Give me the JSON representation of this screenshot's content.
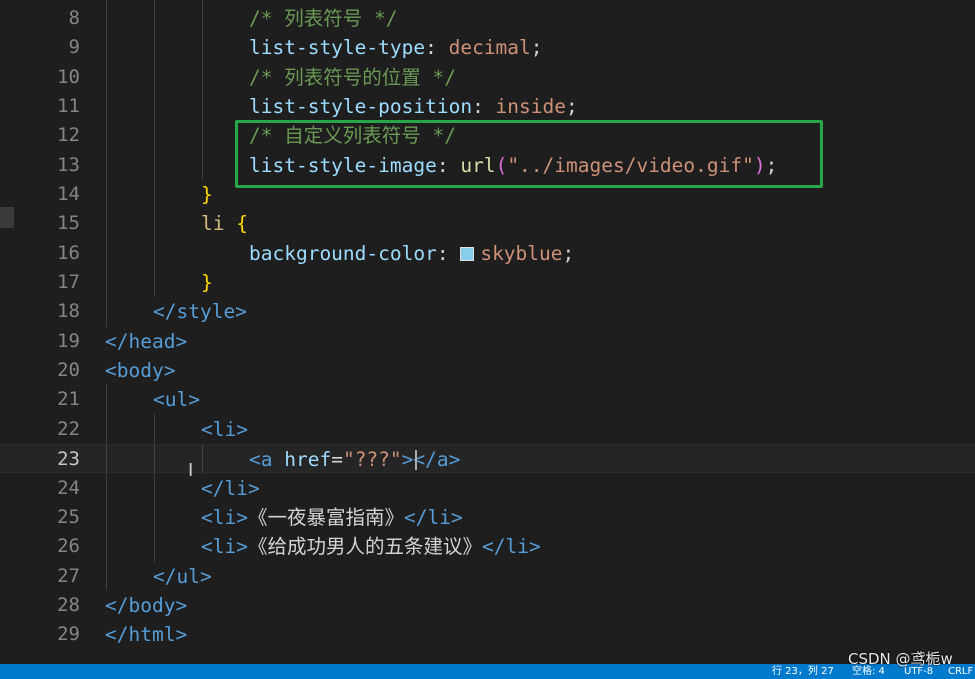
{
  "editor": {
    "active_line": "23",
    "lines": [
      {
        "num": "8"
      },
      {
        "num": "9"
      },
      {
        "num": "10"
      },
      {
        "num": "11"
      },
      {
        "num": "12"
      },
      {
        "num": "13"
      },
      {
        "num": "14"
      },
      {
        "num": "15"
      },
      {
        "num": "16"
      },
      {
        "num": "17"
      },
      {
        "num": "18"
      },
      {
        "num": "19"
      },
      {
        "num": "20"
      },
      {
        "num": "21"
      },
      {
        "num": "22"
      },
      {
        "num": "23"
      },
      {
        "num": "24"
      },
      {
        "num": "25"
      },
      {
        "num": "26"
      },
      {
        "num": "27"
      },
      {
        "num": "28"
      },
      {
        "num": "29"
      }
    ],
    "code": {
      "l8_comment": "/* 列表符号 */",
      "l9_prop": "list-style-type",
      "l9_value": "decimal",
      "l10_comment": "/* 列表符号的位置 */",
      "l11_prop": "list-style-position",
      "l11_value": "inside",
      "l12_comment": "/* 自定义列表符号 */",
      "l13_prop": "list-style-image",
      "l13_func": "url",
      "l13_value": "\"../images/video.gif\"",
      "l14_brace": "}",
      "l15_selector": "li",
      "l15_brace": "{",
      "l16_prop": "background-color",
      "l16_value": "skyblue",
      "l17_brace": "}",
      "l18_tag": "</style>",
      "l19_tag": "</head>",
      "l20_tag": "<body>",
      "l21_tag": "<ul>",
      "l22_tag": "<li>",
      "l23_open": "<a",
      "l23_attr": "href",
      "l23_value": "\"???\"",
      "l23_gt": ">",
      "l23_close": "</a>",
      "l24_tag": "</li>",
      "l25_open": "<li>",
      "l25_text": "《一夜暴富指南》",
      "l25_close": "</li>",
      "l26_open": "<li>",
      "l26_text": "《给成功男人的五条建议》",
      "l26_close": "</li>",
      "l27_tag": "</ul>",
      "l28_tag": "</body>",
      "l29_tag": "</html>"
    },
    "swatch_color": "#87ceeb",
    "highlight_color": "#27a74a"
  },
  "statusbar": {
    "position": "行 23，列 27",
    "spaces": "空格: 4",
    "encoding": "UTF-8",
    "eol": "CRLF"
  },
  "watermark": "CSDN @鸢栀w"
}
